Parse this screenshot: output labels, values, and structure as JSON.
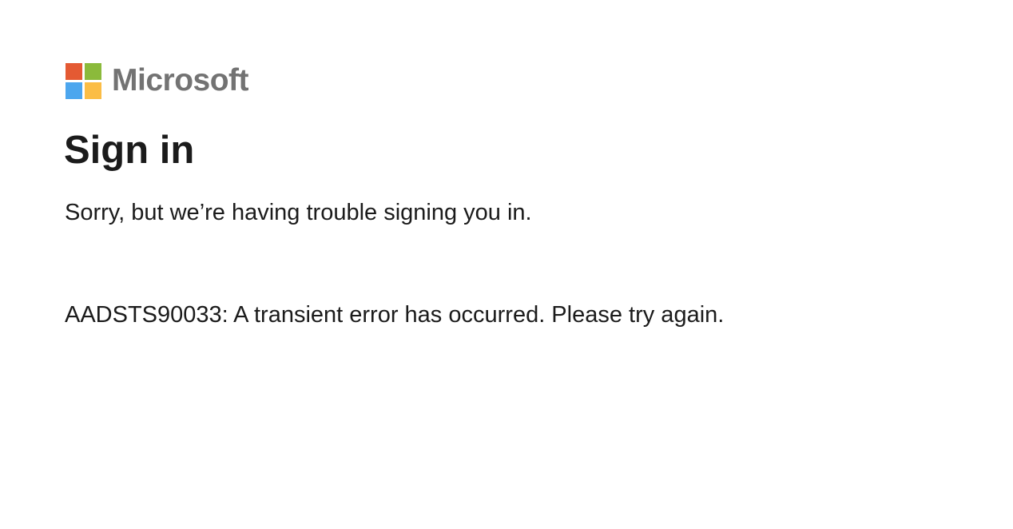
{
  "brand": {
    "name": "Microsoft",
    "logo_icon": "microsoft-logo-icon",
    "colors": {
      "top_left": "#f25022",
      "top_right": "#7fba00",
      "bottom_left": "#00a4ef",
      "bottom_right": "#ffb900",
      "wordmark": "#737373"
    }
  },
  "main": {
    "title": "Sign in",
    "subtitle": "Sorry, but we’re having trouble signing you in.",
    "error_message": "AADSTS90033: A transient error has occurred. Please try again."
  }
}
